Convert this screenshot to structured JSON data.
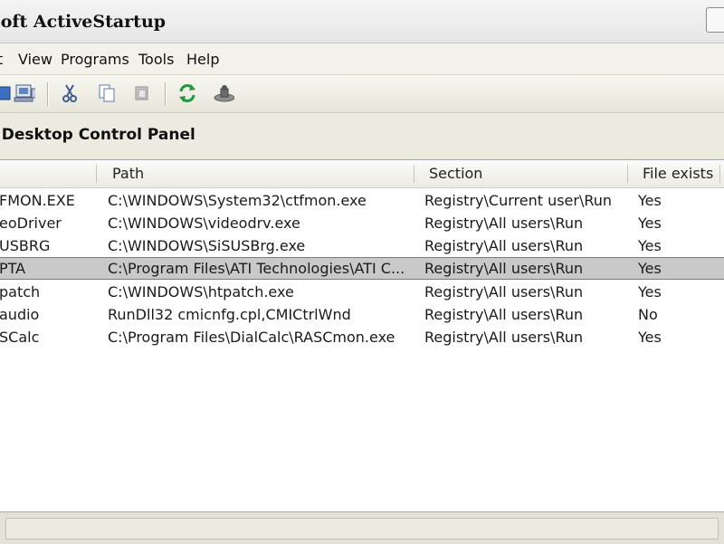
{
  "window": {
    "title": "soft ActiveStartup"
  },
  "menu": [
    "t",
    "View",
    "Programs",
    "Tools",
    "Help"
  ],
  "toolbar": {
    "icons": [
      "computer-icon",
      "cut-icon",
      "copy-icon",
      "paste-icon",
      "refresh-icon",
      "run-icon"
    ]
  },
  "panel": {
    "title": "l Desktop Control Panel"
  },
  "columns": {
    "path": "Path",
    "section": "Section",
    "file_exists": "File exists"
  },
  "rows": [
    {
      "name": "FMON.EXE",
      "path": "C:\\WINDOWS\\System32\\ctfmon.exe",
      "section": "Registry\\Current user\\Run",
      "file_exists": "Yes"
    },
    {
      "name": "eoDriver",
      "path": "C:\\WINDOWS\\videodrv.exe",
      "section": "Registry\\All users\\Run",
      "file_exists": "Yes"
    },
    {
      "name": "USBRG",
      "path": "C:\\WINDOWS\\SiSUSBrg.exe",
      "section": "Registry\\All users\\Run",
      "file_exists": "Yes"
    },
    {
      "name": "PTA",
      "path": "C:\\Program Files\\ATI Technologies\\ATI C...",
      "section": "Registry\\All users\\Run",
      "file_exists": "Yes",
      "selected": true
    },
    {
      "name": "patch",
      "path": "C:\\WINDOWS\\htpatch.exe",
      "section": "Registry\\All users\\Run",
      "file_exists": "Yes"
    },
    {
      "name": "audio",
      "path": "RunDll32 cmicnfg.cpl,CMICtrlWnd",
      "section": "Registry\\All users\\Run",
      "file_exists": "No"
    },
    {
      "name": "SCalc",
      "path": "C:\\Program Files\\DialCalc\\RASCmon.exe",
      "section": "Registry\\All users\\Run",
      "file_exists": "Yes"
    }
  ],
  "colors": {
    "selected_row": "#c9c9c9",
    "window_bg": "#ece9d8"
  }
}
